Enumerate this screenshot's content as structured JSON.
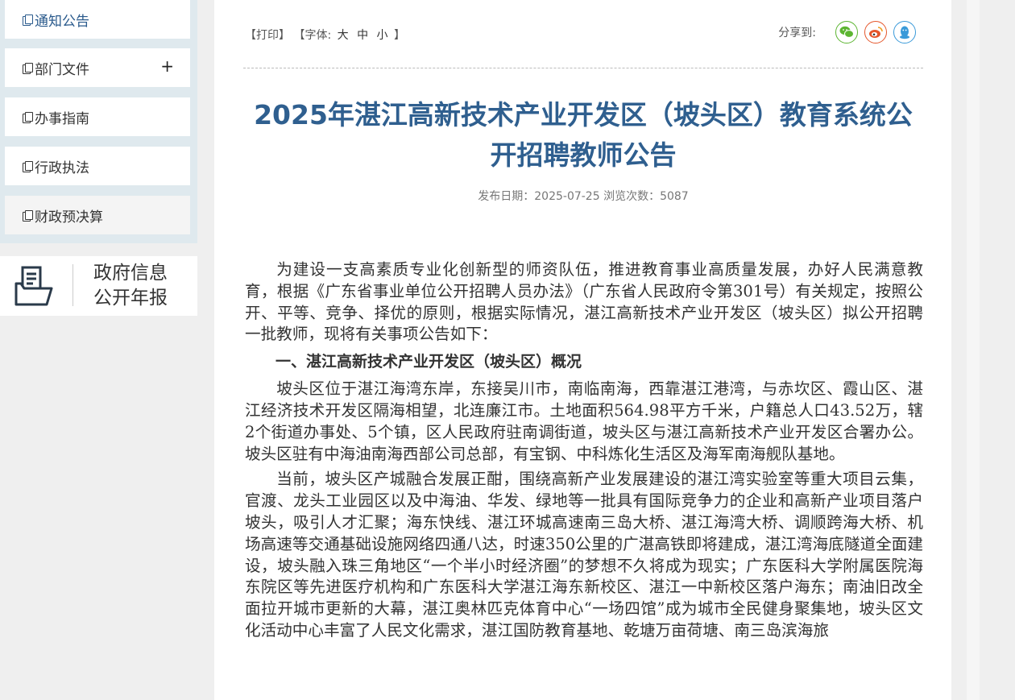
{
  "sidebar": {
    "items": [
      {
        "label": "通知公告",
        "active": true
      },
      {
        "label": "部门文件",
        "expand": "+"
      },
      {
        "label": "办事指南"
      },
      {
        "label": "行政执法"
      },
      {
        "label": "财政预决算"
      }
    ],
    "annual_report": {
      "line1": "政府信息",
      "line2": "公开年报"
    }
  },
  "toolbar": {
    "print": "【打印】",
    "font_prefix": "【字体:",
    "font_large": "大",
    "font_medium": "中",
    "font_small": "小",
    "font_suffix": "】",
    "share_label": "分享到:"
  },
  "share_icons": [
    {
      "name": "wechat-icon",
      "color": "#5cb531"
    },
    {
      "name": "weibo-icon",
      "color": "#e5572c"
    },
    {
      "name": "qq-icon",
      "color": "#3a9ad9"
    }
  ],
  "article": {
    "title": "2025年湛江高新技术产业开发区（坡头区）教育系统公开招聘教师公告",
    "meta": "发布日期：2025-07-25  浏览次数：5087",
    "para1": "为建设一支高素质专业化创新型的师资队伍，推进教育事业高质量发展，办好人民满意教育，根据《广东省事业单位公开招聘人员办法》（广东省人民政府令第301号）有关规定，按照公开、平等、竞争、择优的原则，根据实际情况，湛江高新技术产业开发区（坡头区）拟公开招聘一批教师，现将有关事项公告如下：",
    "heading1": "一、湛江高新技术产业开发区（坡头区）概况",
    "para2": "坡头区位于湛江海湾东岸，东接吴川市，南临南海，西靠湛江港湾，与赤坎区、霞山区、湛江经济技术开发区隔海相望，北连廉江市。土地面积564.98平方千米，户籍总人口43.52万，辖2个街道办事处、5个镇，区人民政府驻南调街道，坡头区与湛江高新技术产业开发区合署办公。坡头区驻有中海油南海西部公司总部，有宝钢、中科炼化生活区及海军南海舰队基地。",
    "para3": "当前，坡头区产城融合发展正酣，围绕高新产业发展建设的湛江湾实验室等重大项目云集，官渡、龙头工业园区以及中海油、华发、绿地等一批具有国际竞争力的企业和高新产业项目落户坡头，吸引人才汇聚；海东快线、湛江环城高速南三岛大桥、湛江海湾大桥、调顺跨海大桥、机场高速等交通基础设施网络四通八达，时速350公里的广湛高铁即将建成，湛江湾海底隧道全面建设，坡头融入珠三角地区“一个半小时经济圈”的梦想不久将成为现实；广东医科大学附属医院海东院区等先进医疗机构和广东医科大学湛江海东新校区、湛江一中新校区落户海东；南油旧改全面拉开城市更新的大幕，湛江奥林匹克体育中心“一场四馆”成为城市全民健身聚集地，坡头区文化活动中心丰富了人民文化需求，湛江国防教育基地、乾塘万亩荷塘、南三岛滨海旅"
  }
}
